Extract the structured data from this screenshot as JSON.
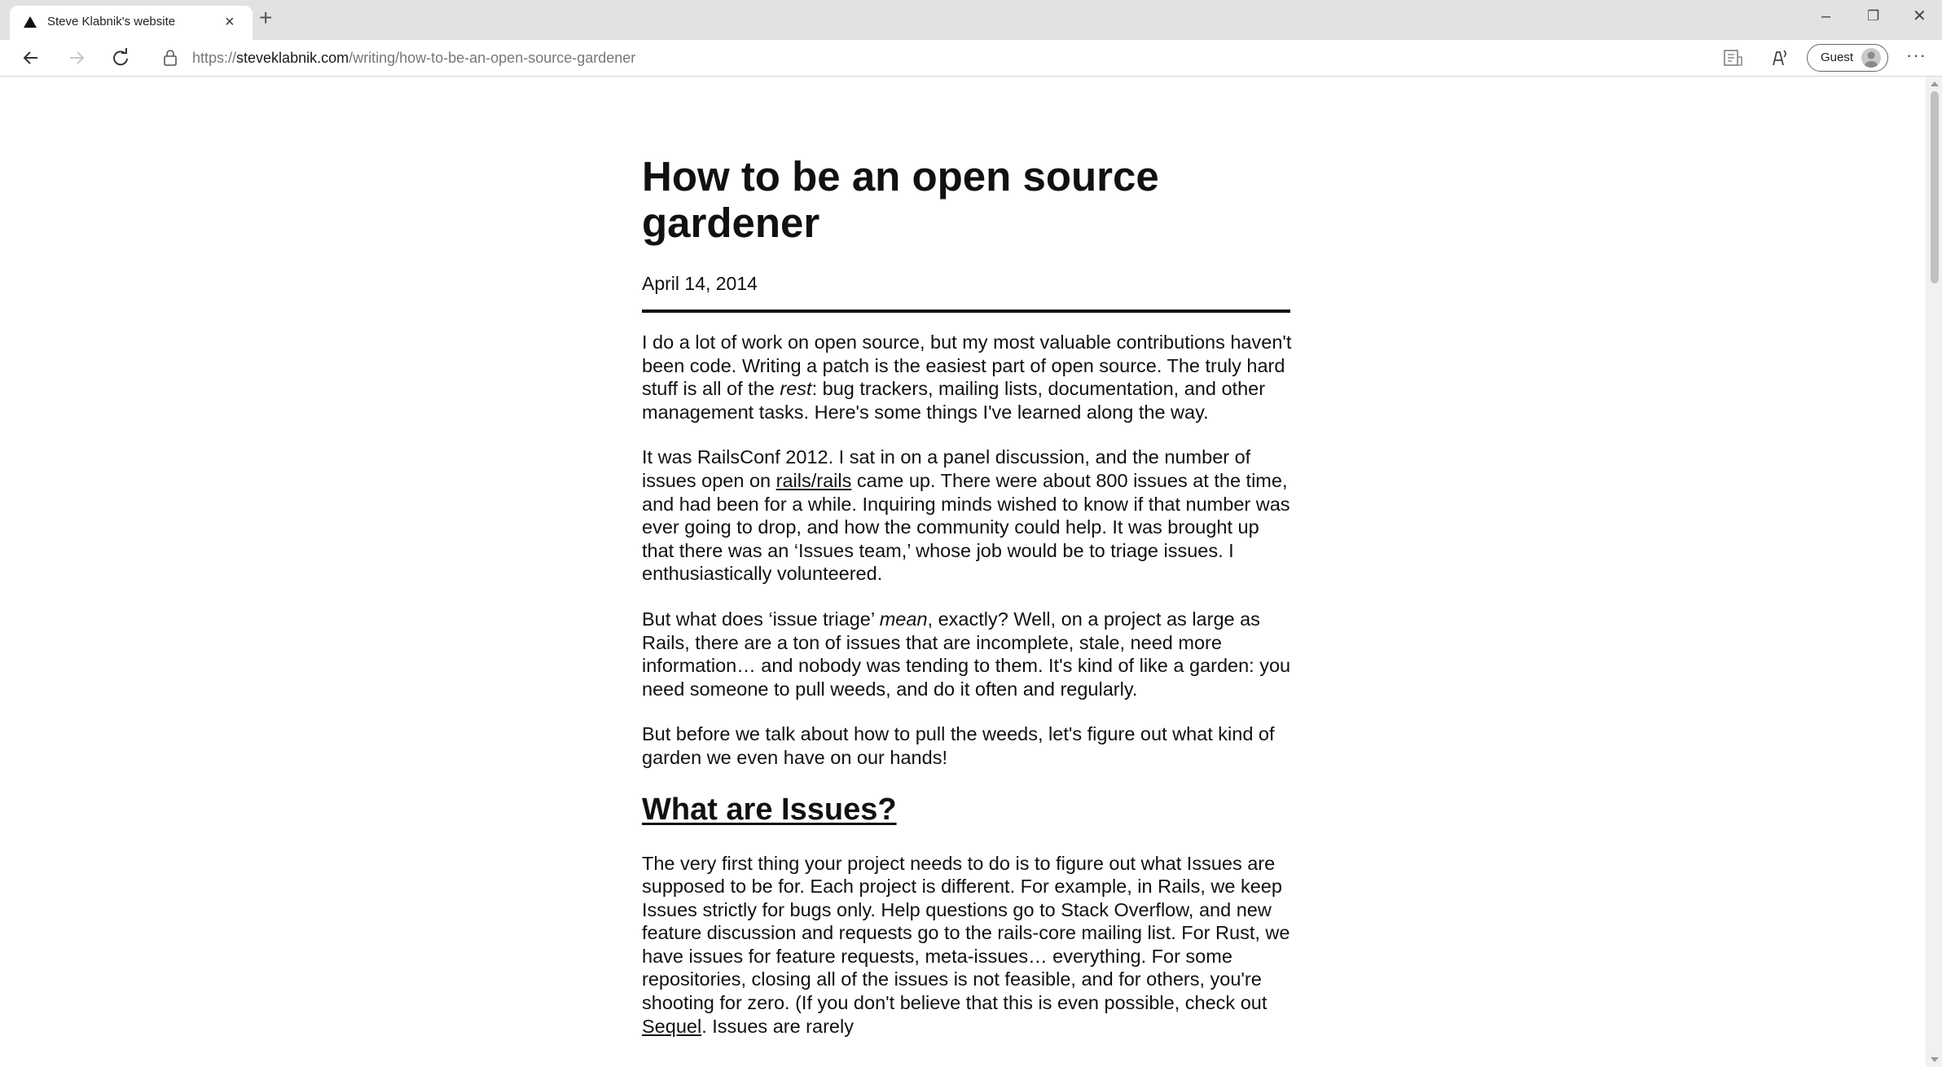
{
  "browser": {
    "tab_title": "Steve Klabnik's website",
    "tab_close": "×",
    "new_tab": "+",
    "url_scheme": "https://",
    "url_host": "steveklabnik.com",
    "url_path": "/writing/how-to-be-an-open-source-gardener",
    "profile_label": "Guest",
    "menu": "···",
    "minimize": "–",
    "restore": "❐",
    "close": "✕"
  },
  "article": {
    "title": "How to be an open source gardener",
    "date": "April 14, 2014",
    "p1": {
      "a": "I do a lot of work on open source, but my most valuable contributions haven't been code. Writing a patch is the easiest part of open source. The truly hard stuff is all of the ",
      "em": "rest",
      "b": ": bug trackers, mailing lists, documentation, and other management tasks. Here's some things I've learned along the way."
    },
    "p2": {
      "a": "It was RailsConf 2012. I sat in on a panel discussion, and the number of issues open on ",
      "link": "rails/rails",
      "b": " came up. There were about 800 issues at the time, and had been for a while. Inquiring minds wished to know if that number was ever going to drop, and how the community could help. It was brought up that there was an ‘Issues team,’ whose job would be to triage issues. I enthusiastically volunteered."
    },
    "p3": {
      "a": "But what does ‘issue triage’ ",
      "em": "mean",
      "b": ", exactly? Well, on a project as large as Rails, there are a ton of issues that are incomplete, stale, need more information… and nobody was tending to them. It's kind of like a garden: you need someone to pull weeds, and do it often and regularly."
    },
    "p4": "But before we talk about how to pull the weeds, let's figure out what kind of garden we even have on our hands!",
    "h2": "What are Issues?",
    "p5": {
      "a": "The very first thing your project needs to do is to figure out what Issues are supposed to be for. Each project is different. For example, in Rails, we keep Issues strictly for bugs only. Help questions go to Stack Overflow, and new feature discussion and requests go to the rails-core mailing list. For Rust, we have issues for feature requests, meta-issues… everything. For some repositories, closing all of the issues is not feasible, and for others, you're shooting for zero. (If you don't believe that this is even possible, check out ",
      "link": "Sequel",
      "b": ". Issues are rarely"
    }
  }
}
